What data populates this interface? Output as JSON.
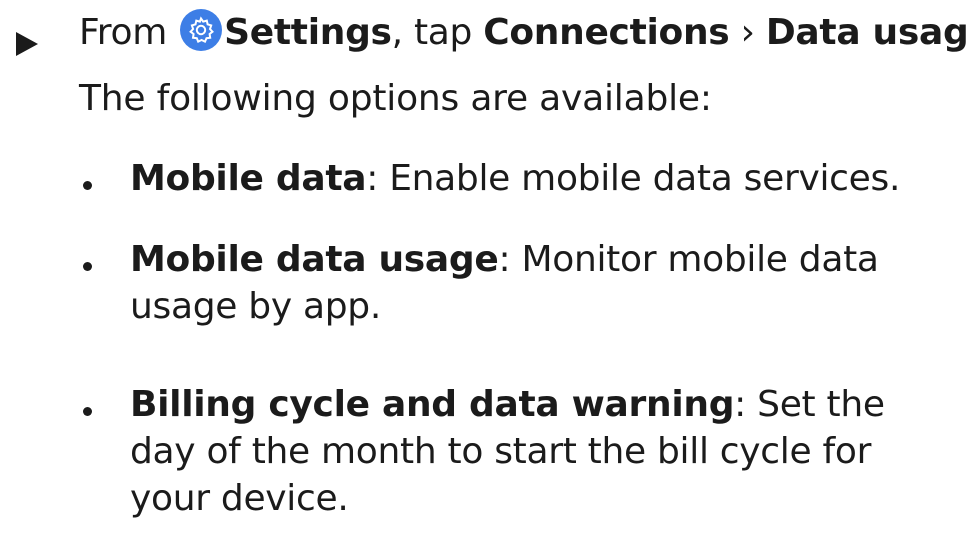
{
  "step": {
    "prefix": "From ",
    "settings_icon": "gear-icon",
    "settings_label": "Settings",
    "middle": ", tap ",
    "connections_label": "Connections",
    "separator": " › ",
    "data_usage_label": "Data usage",
    "suffix": "."
  },
  "intro": "The following options are available:",
  "options": [
    {
      "title": "Mobile data",
      "description": ": Enable mobile data services."
    },
    {
      "title": "Mobile data usage",
      "description": ": Monitor mobile data usage by app."
    },
    {
      "title": "Billing cycle and data warning",
      "description": ": Set the day of the month to start the bill cycle for your device."
    }
  ],
  "colors": {
    "icon_background": "#3d7ee6",
    "text": "#1b1b1b"
  }
}
